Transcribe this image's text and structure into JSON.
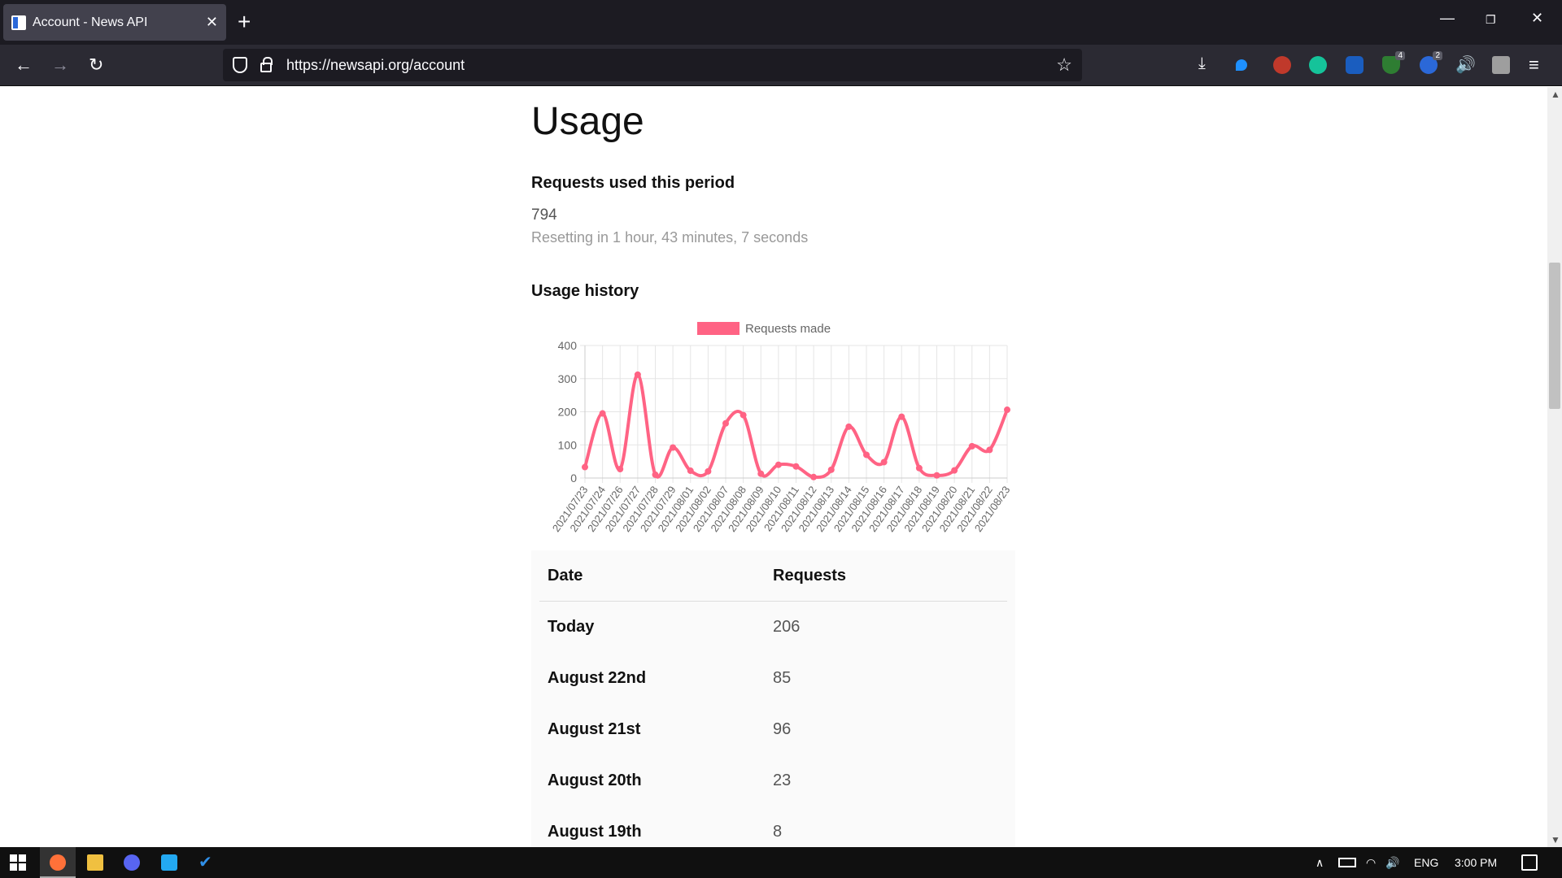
{
  "browser": {
    "tab_title": "Account - News API",
    "tab_close": "✕",
    "new_tab": "+",
    "url": "https://newsapi.org/account",
    "extension_badges": [
      "4",
      "2"
    ]
  },
  "page": {
    "title": "Usage",
    "requests_heading": "Requests used this period",
    "requests_count": "794",
    "resetting_text": "Resetting in 1 hour, 43 minutes, 7 seconds",
    "history_heading": "Usage history"
  },
  "chart_data": {
    "type": "line",
    "legend": "Requests made",
    "color": "#ff6384",
    "ylim": [
      0,
      400
    ],
    "yticks": [
      0,
      100,
      200,
      300,
      400
    ],
    "categories": [
      "2021/07/23",
      "2021/07/24",
      "2021/07/26",
      "2021/07/27",
      "2021/07/28",
      "2021/07/29",
      "2021/08/01",
      "2021/08/02",
      "2021/08/07",
      "2021/08/08",
      "2021/08/09",
      "2021/08/10",
      "2021/08/11",
      "2021/08/12",
      "2021/08/13",
      "2021/08/14",
      "2021/08/15",
      "2021/08/16",
      "2021/08/17",
      "2021/08/18",
      "2021/08/19",
      "2021/08/20",
      "2021/08/21",
      "2021/08/22",
      "2021/08/23"
    ],
    "values": [
      33,
      195,
      27,
      312,
      10,
      92,
      22,
      20,
      165,
      190,
      13,
      40,
      35,
      3,
      25,
      155,
      70,
      48,
      185,
      30,
      8,
      23,
      96,
      85,
      206
    ],
    "grid": true,
    "legend_position": "top"
  },
  "table": {
    "headers": [
      "Date",
      "Requests"
    ],
    "rows": [
      {
        "date": "Today",
        "requests": "206"
      },
      {
        "date": "August 22nd",
        "requests": "85"
      },
      {
        "date": "August 21st",
        "requests": "96"
      },
      {
        "date": "August 20th",
        "requests": "23"
      },
      {
        "date": "August 19th",
        "requests": "8"
      }
    ]
  },
  "taskbar": {
    "language": "ENG",
    "time": "3:00 PM"
  }
}
